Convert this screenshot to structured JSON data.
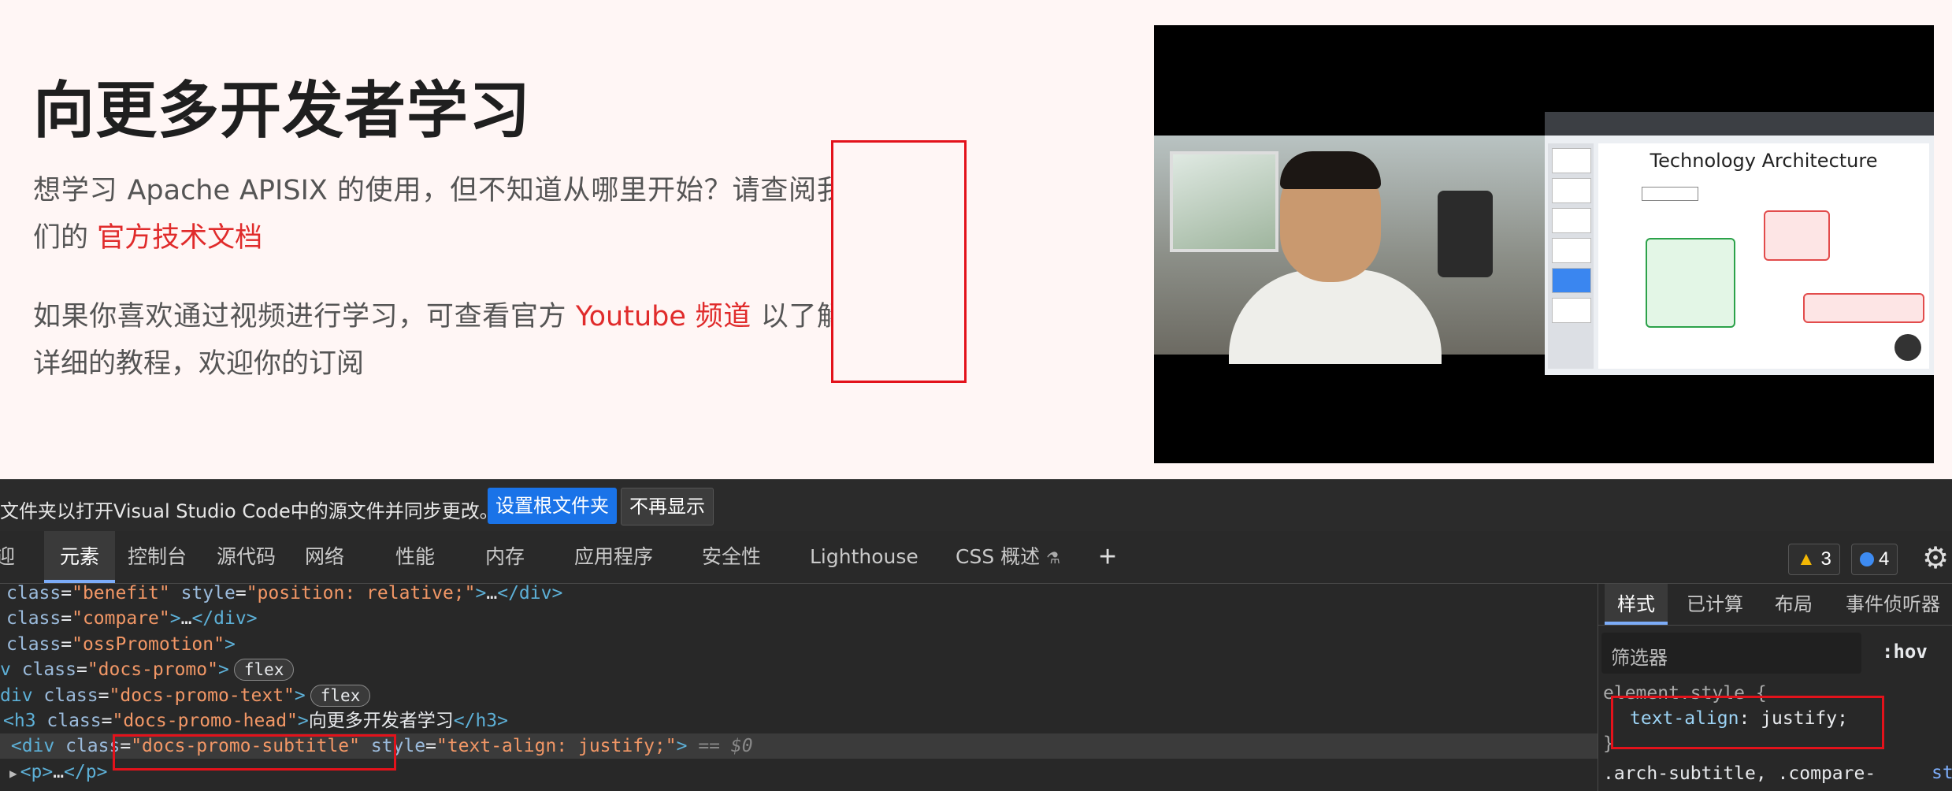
{
  "page": {
    "heading": "向更多开发者学习",
    "p1_before": "想学习 Apache APISIX 的使用，但不知道从哪里开始？请查阅我们的",
    "p1_link": "官方技术文档",
    "p2_before": "如果你喜欢通过视频进行学习，可查看官方",
    "p2_link": "Youtube 频道",
    "p2_after": "以了解详细的教程，欢迎你的订阅"
  },
  "video": {
    "slide_title": "Technology Architecture"
  },
  "devtools": {
    "banner_text": "文件夹以打开Visual Studio Code中的源文件并同步更改。",
    "set_root_button": "设置根文件夹",
    "dont_show_button": "不再显示",
    "tabs": [
      "迎",
      "元素",
      "控制台",
      "源代码",
      "网络",
      "性能",
      "内存",
      "应用程序",
      "安全性",
      "Lighthouse",
      "CSS 概述"
    ],
    "warnings": "3",
    "infos": "4",
    "dom_lines": {
      "l1_attr1": "class",
      "l1_val1": "\"benefit\"",
      "l1_attr2": "style",
      "l1_val2": "\"position: relative;\"",
      "l2_val": "\"compare\"",
      "l3_val": "\"ossPromotion\"",
      "l4_val": "\"docs-promo\"",
      "l5_val": "\"docs-promo-text\"",
      "l6_val": "\"docs-promo-head\"",
      "l6_text": "向更多开发者学习",
      "l7_val": "\"docs-promo-subtitle\"",
      "l7_style": "\"text-align: justify;\"",
      "l7_eq": "== $0",
      "flex": "flex",
      "ellipsis": "…"
    },
    "styles": {
      "tabs": [
        "样式",
        "已计算",
        "布局",
        "事件侦听器"
      ],
      "filter_placeholder": "筛选器",
      "hov": ":hov",
      "rule1_selector": "element.style {",
      "rule1_prop": "text-align",
      "rule1_value": "justify;",
      "rule1_close": "}",
      "rule2_selector": ".arch-subtitle, .compare-",
      "source_link": "st"
    }
  }
}
